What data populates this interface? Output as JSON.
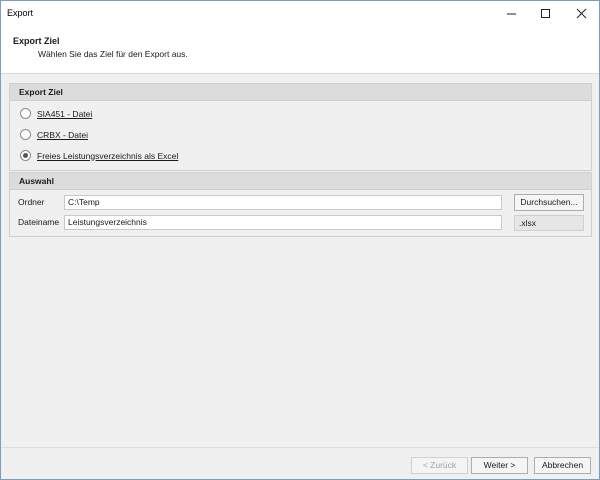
{
  "window": {
    "title": "Export"
  },
  "header": {
    "title": "Export Ziel",
    "subtitle": "Wählen Sie das Ziel für den Export aus."
  },
  "export_target": {
    "title": "Export Ziel",
    "options": [
      {
        "label": "SIA451 - Datei",
        "selected": false
      },
      {
        "label": "CRBX - Datei",
        "selected": false
      },
      {
        "label": "Freies Leistungsverzeichnis als Excel",
        "selected": true
      }
    ]
  },
  "selection": {
    "title": "Auswahl",
    "folder_label": "Ordner",
    "folder_value": "C:\\Temp",
    "browse_label": "Durchsuchen...",
    "filename_label": "Dateiname",
    "filename_value": "Leistungsverzeichnis",
    "extension": ".xlsx"
  },
  "footer": {
    "back_label": "< Zurück",
    "next_label": "Weiter >",
    "cancel_label": "Abbrechen"
  }
}
